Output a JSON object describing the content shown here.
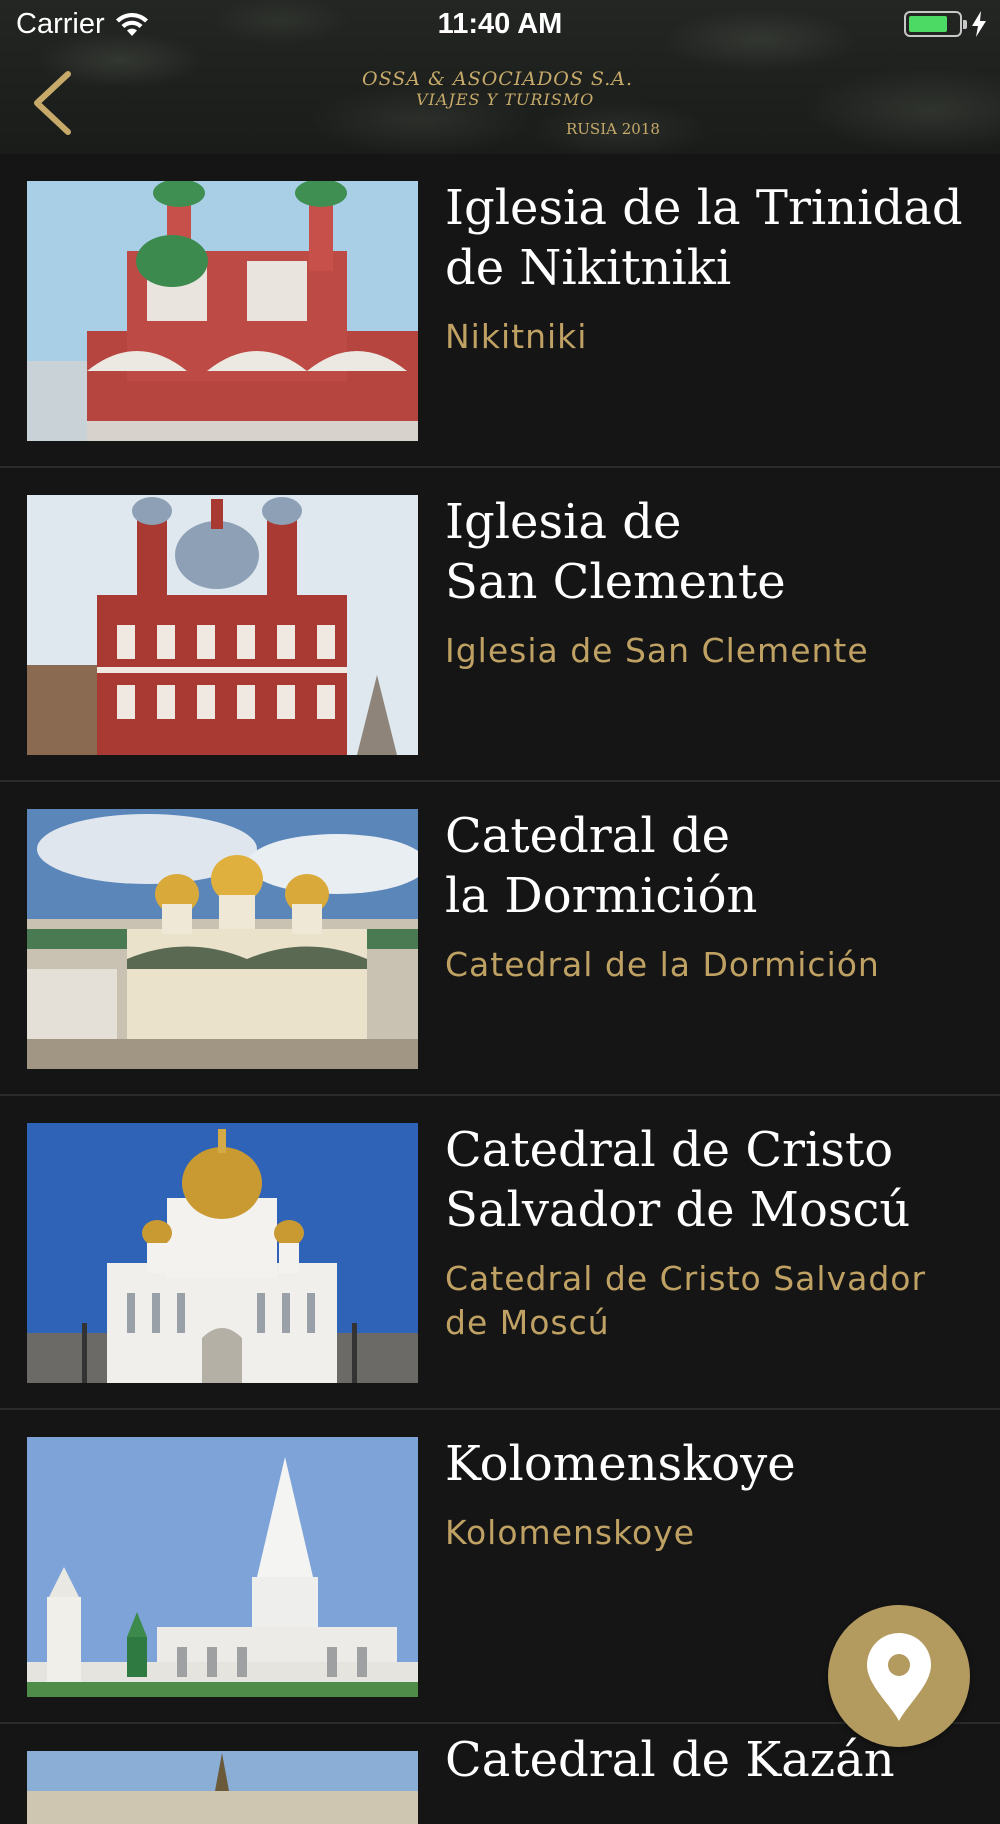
{
  "status_bar": {
    "carrier": "Carrier",
    "time": "11:40 AM",
    "battery_level": 0.7,
    "charging": true
  },
  "header": {
    "brand_line1": "OSSA & ASOCIADOS S.A.",
    "brand_line2": "VIAJES Y TURISMO",
    "brand_line3": "RUSIA 2018",
    "back_icon": "chevron-left-icon",
    "accent_color": "#c7aa6a"
  },
  "items": [
    {
      "title": "Iglesia de la Trinidad\nde Nikitniki",
      "subtitle": "Nikitniki"
    },
    {
      "title": "Iglesia de\nSan Clemente",
      "subtitle": "Iglesia de San Clemente"
    },
    {
      "title": "Catedral de\nla Dormición",
      "subtitle": "Catedral de la Dormición"
    },
    {
      "title": "Catedral de Cristo\nSalvador de Moscú",
      "subtitle": "Catedral de Cristo Salvador de Moscú"
    },
    {
      "title": "Kolomenskoye",
      "subtitle": "Kolomenskoye"
    },
    {
      "title": "Catedral de Kazán",
      "subtitle": ""
    }
  ],
  "fab": {
    "icon": "map-pin-icon",
    "color": "#b39a5e"
  }
}
